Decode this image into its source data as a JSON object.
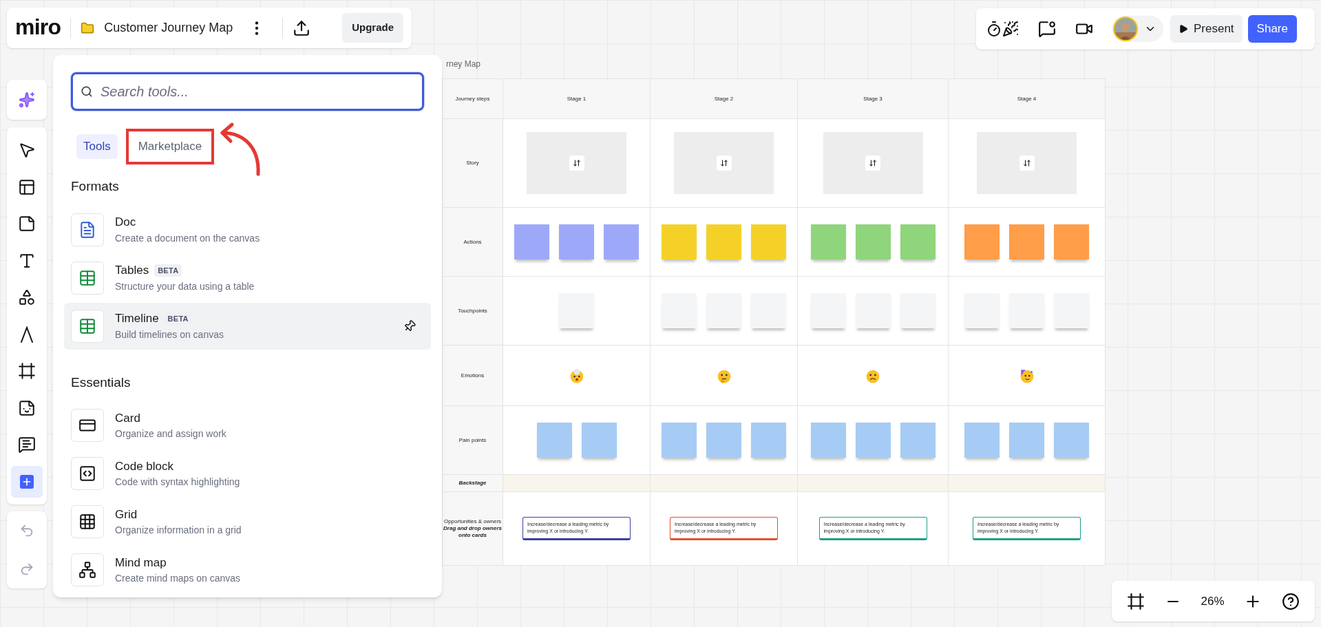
{
  "header": {
    "logo": "miro",
    "board_title": "Customer Journey Map",
    "upgrade": "Upgrade"
  },
  "top_right": {
    "actions": [
      {
        "kind": "timer"
      },
      {
        "kind": "activity"
      },
      {
        "kind": "video"
      }
    ],
    "present": "Present",
    "share": "Share"
  },
  "toolbar": {
    "ai_tools": [
      {
        "kind": "ai",
        "selected": false
      }
    ],
    "tools": [
      {
        "kind": "select",
        "selected": false
      },
      {
        "kind": "templates",
        "selected": false
      },
      {
        "kind": "sticky",
        "selected": false
      },
      {
        "kind": "text",
        "selected": false
      },
      {
        "kind": "shapes",
        "selected": false
      },
      {
        "kind": "pen",
        "selected": false
      },
      {
        "kind": "frame",
        "selected": false
      },
      {
        "kind": "stickers",
        "selected": false
      },
      {
        "kind": "comment",
        "selected": false
      },
      {
        "kind": "add",
        "selected": true
      }
    ],
    "history": [
      {
        "kind": "undo",
        "disabled": true
      },
      {
        "kind": "redo",
        "disabled": true
      }
    ]
  },
  "tools_panel": {
    "search": {
      "placeholder": "Search tools..."
    },
    "tabs": [
      {
        "label": "Tools",
        "selected": true,
        "highlighted": false
      },
      {
        "label": "Marketplace",
        "selected": false,
        "highlighted": true
      }
    ],
    "sections": [
      {
        "title": "Formats",
        "items": [
          {
            "kind": "doc",
            "title": "Doc",
            "description": "Create a document on the canvas",
            "hovered": false
          },
          {
            "kind": "table",
            "title": "Tables",
            "badge": "BETA",
            "description": "Structure your data using a table",
            "hovered": false
          },
          {
            "kind": "table",
            "title": "Timeline",
            "badge": "BETA",
            "description": "Build timelines on canvas",
            "hovered": true
          }
        ]
      },
      {
        "title": "Essentials",
        "items": [
          {
            "kind": "card",
            "title": "Card",
            "description": "Organize and assign work",
            "hovered": false
          },
          {
            "kind": "code",
            "title": "Code block",
            "description": "Code with syntax highlighting",
            "hovered": false
          },
          {
            "kind": "grid",
            "title": "Grid",
            "description": "Organize information in a grid",
            "hovered": false
          },
          {
            "kind": "mindmap",
            "title": "Mind map",
            "description": "Create mind maps on canvas",
            "hovered": false
          }
        ]
      }
    ]
  },
  "board": {
    "title": "rney Map",
    "columns": [
      "Journey steps",
      "Stage 1",
      "Stage 2",
      "Stage 3",
      "Stage 4"
    ],
    "rows": [
      {
        "label": "Story",
        "cells": [
          {
            "kind": "placeholder"
          },
          {
            "kind": "placeholder"
          },
          {
            "kind": "placeholder"
          },
          {
            "kind": "placeholder"
          }
        ]
      },
      {
        "kind": "notes",
        "label": "Actions",
        "cells": [
          {
            "notes": [
              {
                "color": "#9ea8f8"
              },
              {
                "color": "#9ea8f8"
              },
              {
                "color": "#9ea8f8"
              }
            ]
          },
          {
            "notes": [
              {
                "color": "#f5d128"
              },
              {
                "color": "#f5d128"
              },
              {
                "color": "#f5d128"
              }
            ]
          },
          {
            "notes": [
              {
                "color": "#8fd57c"
              },
              {
                "color": "#8fd57c"
              },
              {
                "color": "#8fd57c"
              }
            ]
          },
          {
            "notes": [
              {
                "color": "#ff9d48"
              },
              {
                "color": "#ff9d48"
              },
              {
                "color": "#ff9d48"
              }
            ]
          }
        ]
      },
      {
        "kind": "notes",
        "label": "Touchpoints",
        "cells": [
          {
            "notes": [
              {
                "color": "#f4f5f7"
              }
            ]
          },
          {
            "notes": [
              {
                "color": "#f4f5f7"
              },
              {
                "color": "#f4f5f7"
              },
              {
                "color": "#f4f5f7"
              }
            ]
          },
          {
            "notes": [
              {
                "color": "#f4f5f7"
              },
              {
                "color": "#f4f5f7"
              },
              {
                "color": "#f4f5f7"
              }
            ]
          },
          {
            "notes": [
              {
                "color": "#f4f5f7"
              },
              {
                "color": "#f4f5f7"
              },
              {
                "color": "#f4f5f7"
              }
            ]
          }
        ]
      },
      {
        "kind": "emoji",
        "label": "Emotions",
        "cells": [
          {
            "kind": "mind-blown"
          },
          {
            "kind": "thinking"
          },
          {
            "kind": "worried"
          },
          {
            "kind": "party"
          }
        ]
      },
      {
        "kind": "notes",
        "label": "Pain points",
        "cells": [
          {
            "notes": [
              {
                "color": "#a6ccf5"
              },
              {
                "color": "#a6ccf5"
              }
            ]
          },
          {
            "notes": [
              {
                "color": "#a6ccf5"
              },
              {
                "color": "#a6ccf5"
              },
              {
                "color": "#a6ccf5"
              }
            ]
          },
          {
            "notes": [
              {
                "color": "#a6ccf5"
              },
              {
                "color": "#a6ccf5"
              },
              {
                "color": "#a6ccf5"
              }
            ]
          },
          {
            "notes": [
              {
                "color": "#a6ccf5"
              },
              {
                "color": "#a6ccf5"
              },
              {
                "color": "#a6ccf5"
              }
            ]
          }
        ]
      },
      {
        "kind": "band",
        "label": "Backstage"
      },
      {
        "kind": "cards",
        "label": "Opportunities & owners",
        "sublabel": "Drag and drop owners onto cards",
        "cells": [
          {
            "text": "Increase/decrease a leading metric by improving X or introducing Y.",
            "color": "#3c3f9f"
          },
          {
            "text": "Increase/decrease a leading metric by improving X or introducing Y.",
            "color": "#e0502f"
          },
          {
            "text": "Increase/decrease a leading metric by improving X or introducing Y.",
            "color": "#1f9e8a"
          },
          {
            "text": "Increase/decrease a leading metric by improving X or introducing Y.",
            "color": "#1f9e8a"
          }
        ]
      }
    ]
  },
  "zoom": {
    "value": "26%"
  }
}
